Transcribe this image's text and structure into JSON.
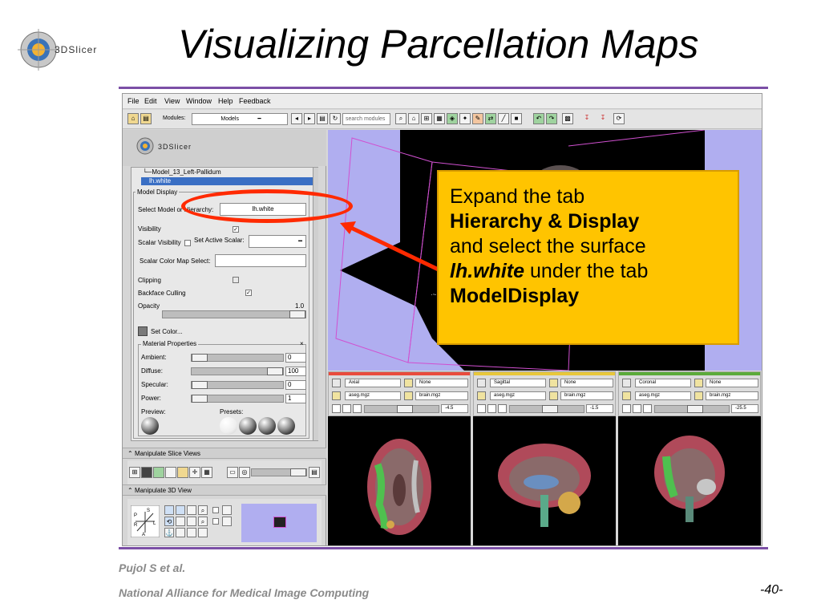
{
  "slide": {
    "logo_text": "3DSlicer",
    "title": "Visualizing Parcellation Maps",
    "footer_author": "Pujol S et al.",
    "footer_org": "National Alliance for Medical Image Computing",
    "page_number": "-40-"
  },
  "app": {
    "menu": [
      "File",
      "Edit",
      "View",
      "Window",
      "Help",
      "Feedback"
    ],
    "toolbar": {
      "modules_label": "Modules:",
      "module_value": "Models",
      "search_placeholder": "search modules"
    },
    "left_panel": {
      "logo_text": "3DSlicer",
      "tree_item": "Model_13_Left-Pallidum",
      "tree_selected": "lh.white",
      "model_display_title": "Model Display",
      "select_label": "Select Model or Hierarchy:",
      "select_value": "lh.white",
      "visibility_label": "Visibility",
      "scalar_visibility_label": "Scalar Visibility",
      "set_active_scalar_label": "Set Active Scalar:",
      "scalar_color_map_label": "Scalar Color Map Select:",
      "clipping_label": "Clipping",
      "backface_label": "Backface Culling",
      "opacity_label": "Opacity",
      "opacity_value": "1.0",
      "set_color_label": "Set Color...",
      "material_title": "Material Properties",
      "ambient_label": "Ambient:",
      "ambient_value": "0",
      "diffuse_label": "Diffuse:",
      "diffuse_value": "100",
      "specular_label": "Specular:",
      "specular_value": "0",
      "power_label": "Power:",
      "power_value": "1",
      "preview_label": "Preview:",
      "presets_label": "Presets:",
      "manipulate_slice_label": "Manipulate Slice Views",
      "manipulate_3d_label": "Manipulate 3D View"
    },
    "slice_views": [
      {
        "name": "Axial",
        "fg": "None",
        "label": "aseg.mgz",
        "bg": "brain.mgz",
        "offset": "-4.5",
        "color": "#e94b3c"
      },
      {
        "name": "Sagittal",
        "fg": "None",
        "label": "aseg.mgz",
        "bg": "brain.mgz",
        "offset": "-1.5",
        "color": "#e8c73a"
      },
      {
        "name": "Coronal",
        "fg": "None",
        "label": "aseg.mgz",
        "bg": "brain.mgz",
        "offset": "-25.5",
        "color": "#5bab3a"
      }
    ]
  },
  "callout": {
    "line1": "Expand the tab",
    "line2": "Hierarchy & Display",
    "line3": "and select the surface",
    "line4_bold": "lh.white",
    "line4_rest": " under the tab",
    "line5": "ModelDisplay"
  },
  "colors": {
    "accent_purple": "#7b4fa6",
    "callout_bg": "#ffc400",
    "annotation_red": "#ff2a00",
    "view3d_bg": "#b0aef0",
    "selection_blue": "#3a6fc4"
  }
}
